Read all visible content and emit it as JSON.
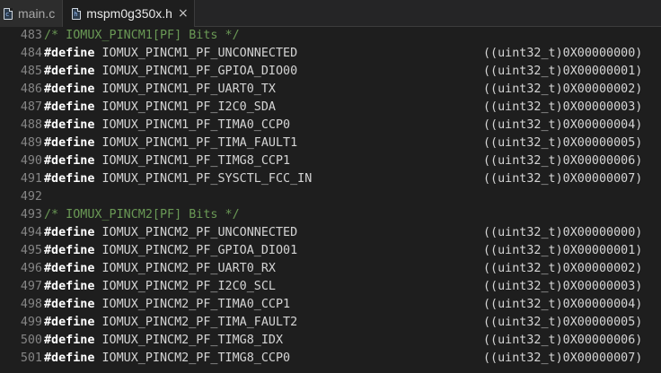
{
  "tabs": [
    {
      "label": "main.c",
      "icon": "c-file-icon",
      "active": false
    },
    {
      "label": "mspm0g350x.h",
      "icon": "header-file-icon",
      "active": true,
      "close": "×"
    }
  ],
  "keyword": "#define",
  "lines": [
    {
      "num": "483",
      "comment": "/* IOMUX_PINCM1[PF] Bits */"
    },
    {
      "num": "484",
      "macro": "IOMUX_PINCM1_PF_UNCONNECTED",
      "value": "((uint32_t)0X00000000)"
    },
    {
      "num": "485",
      "macro": "IOMUX_PINCM1_PF_GPIOA_DIO00",
      "value": "((uint32_t)0X00000001)"
    },
    {
      "num": "486",
      "macro": "IOMUX_PINCM1_PF_UART0_TX",
      "value": "((uint32_t)0X00000002)"
    },
    {
      "num": "487",
      "macro": "IOMUX_PINCM1_PF_I2C0_SDA",
      "value": "((uint32_t)0X00000003)"
    },
    {
      "num": "488",
      "macro": "IOMUX_PINCM1_PF_TIMA0_CCP0",
      "value": "((uint32_t)0X00000004)"
    },
    {
      "num": "489",
      "macro": "IOMUX_PINCM1_PF_TIMA_FAULT1",
      "value": "((uint32_t)0X00000005)"
    },
    {
      "num": "490",
      "macro": "IOMUX_PINCM1_PF_TIMG8_CCP1",
      "value": "((uint32_t)0X00000006)"
    },
    {
      "num": "491",
      "macro": "IOMUX_PINCM1_PF_SYSCTL_FCC_IN",
      "value": "((uint32_t)0X00000007)"
    },
    {
      "num": "492"
    },
    {
      "num": "493",
      "comment": "/* IOMUX_PINCM2[PF] Bits */"
    },
    {
      "num": "494",
      "macro": "IOMUX_PINCM2_PF_UNCONNECTED",
      "value": "((uint32_t)0X00000000)"
    },
    {
      "num": "495",
      "macro": "IOMUX_PINCM2_PF_GPIOA_DIO01",
      "value": "((uint32_t)0X00000001)"
    },
    {
      "num": "496",
      "macro": "IOMUX_PINCM2_PF_UART0_RX",
      "value": "((uint32_t)0X00000002)"
    },
    {
      "num": "497",
      "macro": "IOMUX_PINCM2_PF_I2C0_SCL",
      "value": "((uint32_t)0X00000003)"
    },
    {
      "num": "498",
      "macro": "IOMUX_PINCM2_PF_TIMA0_CCP1",
      "value": "((uint32_t)0X00000004)"
    },
    {
      "num": "499",
      "macro": "IOMUX_PINCM2_PF_TIMA_FAULT2",
      "value": "((uint32_t)0X00000005)"
    },
    {
      "num": "500",
      "macro": "IOMUX_PINCM2_PF_TIMG8_IDX",
      "value": "((uint32_t)0X00000006)"
    },
    {
      "num": "501",
      "macro": "IOMUX_PINCM2_PF_TIMG8_CCP0",
      "value": "((uint32_t)0X00000007)"
    }
  ]
}
